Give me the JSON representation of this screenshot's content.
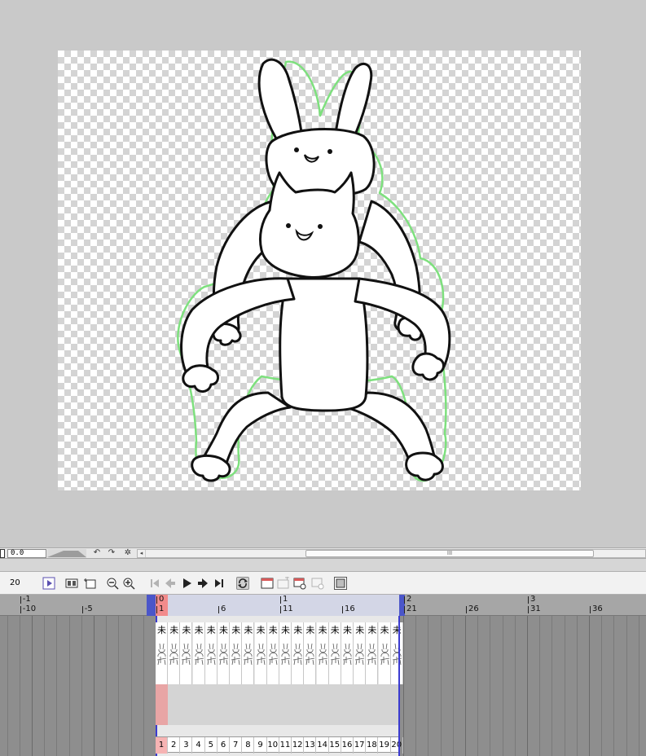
{
  "status_bar": {
    "zoom_value": "0.0",
    "icons": [
      "rotate-left-icon",
      "rotate-right-icon",
      "reset-rotation-icon"
    ],
    "scroll_thumb_grip": "III"
  },
  "timeline_toolbar": {
    "frame_count": "20",
    "buttons": [
      "new-animation-folder",
      "playback-settings",
      "insert-frame",
      "zoom-out",
      "zoom-in",
      "go-to-start",
      "previous-frame",
      "play",
      "next-frame",
      "go-to-end",
      "loop-playback",
      "new-cel",
      "new-cel-folder",
      "assign-cel",
      "delete-cel",
      "onion-skin"
    ],
    "loop_active": true
  },
  "timeline": {
    "ruler_top": [
      {
        "label": "-1",
        "col": -10
      },
      {
        "label": "0",
        "col": 1
      },
      {
        "label": "1",
        "col": 11
      },
      {
        "label": "2",
        "col": 21
      },
      {
        "label": "3",
        "col": 31
      }
    ],
    "ruler_bottom": [
      {
        "label": "-10",
        "col": -10
      },
      {
        "label": "-5",
        "col": -5
      },
      {
        "label": "1",
        "col": 1
      },
      {
        "label": "6",
        "col": 6
      },
      {
        "label": "11",
        "col": 11
      },
      {
        "label": "16",
        "col": 16
      },
      {
        "label": "21",
        "col": 21
      },
      {
        "label": "26",
        "col": 26
      },
      {
        "label": "31",
        "col": 31
      },
      {
        "label": "36",
        "col": 36
      }
    ],
    "current_frame": 1,
    "playback_start": 1,
    "playback_end": 20,
    "keyframe_glyph": "未",
    "frame_numbers": [
      "1",
      "2",
      "3",
      "4",
      "5",
      "6",
      "7",
      "8",
      "9",
      "10",
      "11",
      "12",
      "13",
      "14",
      "15",
      "16",
      "17",
      "18",
      "19",
      "20"
    ]
  },
  "canvas": {
    "layers": [
      "rabbit-character",
      "cat-character",
      "onion-skin-previous"
    ],
    "onion_color": "#7ee07e",
    "line_color": "#111111"
  }
}
